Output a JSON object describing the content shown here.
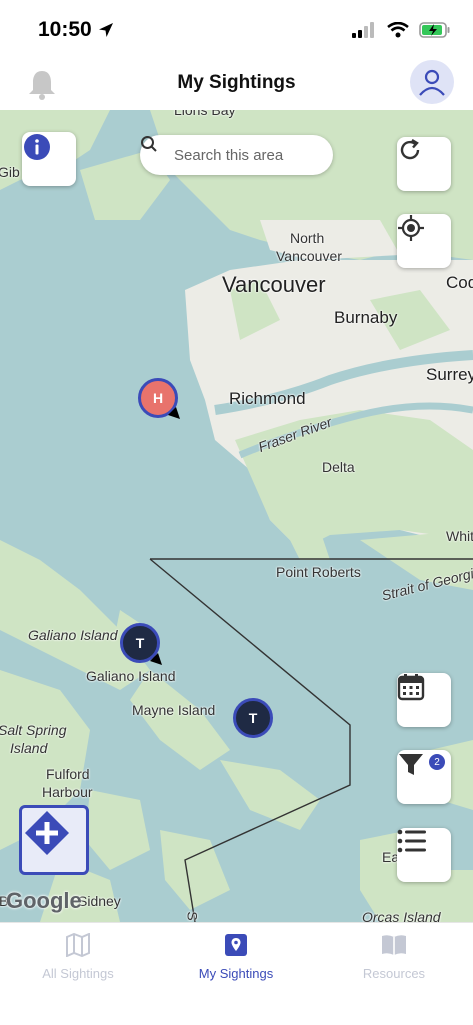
{
  "status": {
    "time": "10:50"
  },
  "header": {
    "title": "My Sightings"
  },
  "search": {
    "placeholder": "Search this area"
  },
  "map_labels": {
    "lions_bay": "Lions Bay",
    "gib": "Gib",
    "north_vancouver_1": "North",
    "north_vancouver_2": "Vancouver",
    "vancouver": "Vancouver",
    "coq": "Coq",
    "burnaby": "Burnaby",
    "surrey": "Surrey",
    "richmond": "Richmond",
    "fraser_river": "Fraser River",
    "delta": "Delta",
    "whit": "Whit",
    "point_roberts": "Point Roberts",
    "strait": "Strait of Georgia",
    "galiano_island_it": "Galiano Island",
    "galiano_island": "Galiano Island",
    "mayne_island": "Mayne Island",
    "salt_spring_1": "Salt Spring",
    "salt_spring_2": "Island",
    "fulford_1": "Fulford",
    "fulford_2": "Harbour",
    "sidney": "Sidney",
    "orcas_island": "Orcas Island",
    "ea": "Ea",
    "s": "S",
    "google": "Google",
    "b": "B"
  },
  "markers": [
    {
      "letter": "H",
      "color": "#e8736c"
    },
    {
      "letter": "T",
      "color": "#1f2a44"
    },
    {
      "letter": "T",
      "color": "#1f2a44"
    }
  ],
  "filter_badge": "2",
  "tabs": {
    "all_sightings": "All Sightings",
    "my_sightings": "My Sightings",
    "resources": "Resources"
  },
  "colors": {
    "accent": "#3b4bb8",
    "water": "#aacdd0",
    "land": "#cfe4c4",
    "urban": "#ecece6"
  }
}
